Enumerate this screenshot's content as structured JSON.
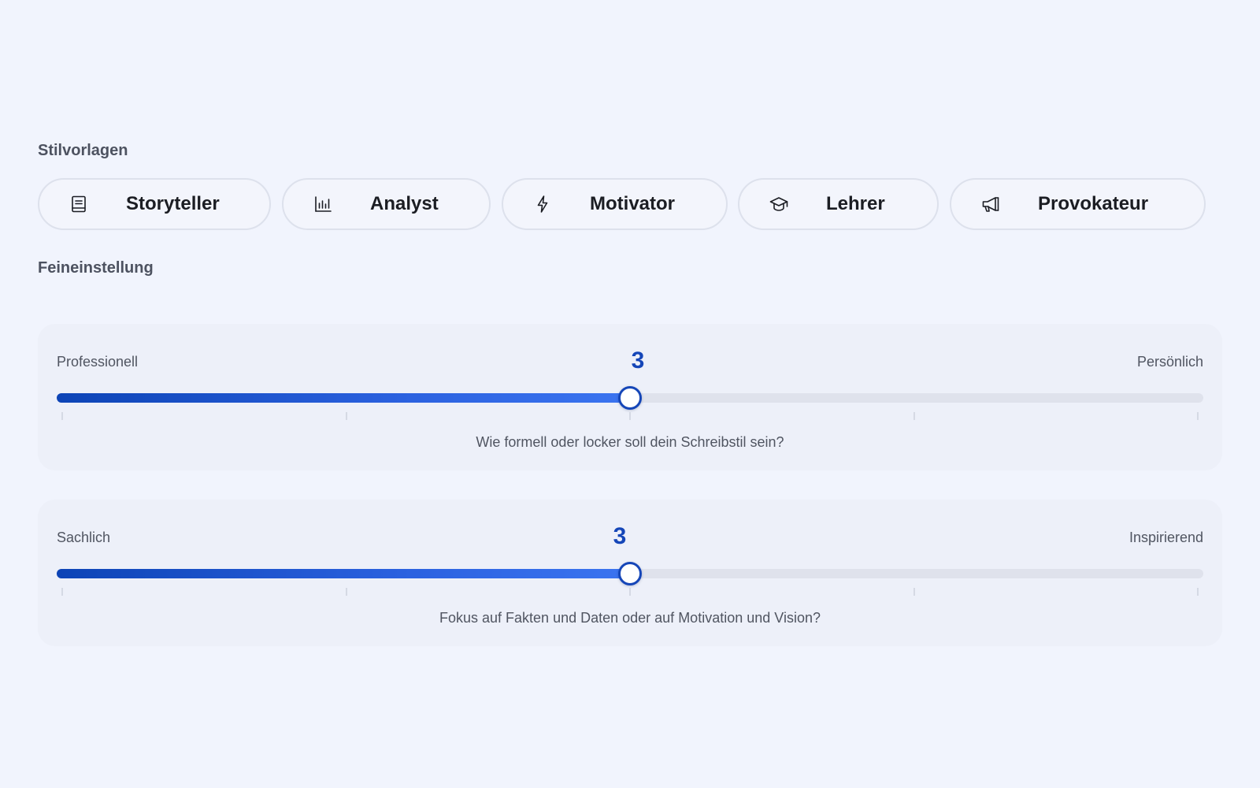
{
  "sections": {
    "presets_title": "Stilvorlagen",
    "fine_title": "Feineinstellung"
  },
  "presets": [
    {
      "label": "Storyteller",
      "icon": "book-icon"
    },
    {
      "label": "Analyst",
      "icon": "bar-chart-icon"
    },
    {
      "label": "Motivator",
      "icon": "lightning-icon"
    },
    {
      "label": "Lehrer",
      "icon": "graduation-cap-icon"
    },
    {
      "label": "Provokateur",
      "icon": "megaphone-icon"
    }
  ],
  "sliders": [
    {
      "left_label": "Professionell",
      "right_label": "Persönlich",
      "value": "3",
      "level_fraction": 0.5,
      "hint": "Wie formell oder locker soll dein Schreibstil sein?"
    },
    {
      "left_label": "Sachlich",
      "right_label": "Inspirierend",
      "value": "3",
      "level_fraction": 0.5,
      "hint": "Fokus auf Fakten und Daten oder auf Motivation und Vision?"
    }
  ],
  "colors": {
    "accent": "#1546b8",
    "background": "#f1f4fd",
    "track": "#dfe2ec"
  }
}
